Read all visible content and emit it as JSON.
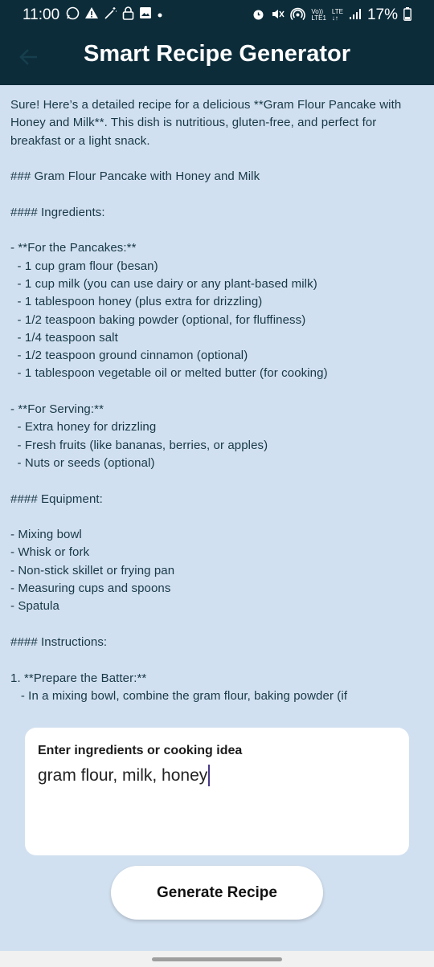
{
  "status_bar": {
    "time": "11:00",
    "left_icons": [
      "whatsapp-icon",
      "warning-icon",
      "magic-icon",
      "lock-icon",
      "image-icon",
      "dot-icon"
    ],
    "right_icons": [
      "alarm-icon",
      "mute-icon",
      "hotspot-icon",
      "volte-icon",
      "lte-icon",
      "signal-icon",
      "battery-icon"
    ],
    "volte_top": "Vo))",
    "volte_bottom": "LTE1",
    "lte_top": "LTE",
    "lte_bottom": "↓↑",
    "battery_pct": "17%"
  },
  "app_bar": {
    "title": "Smart Recipe Generator",
    "back_icon": "arrow-back-icon"
  },
  "recipe": {
    "text": "Sure! Here’s a detailed recipe for a delicious **Gram Flour Pancake with Honey and Milk**. This dish is nutritious, gluten-free, and perfect for breakfast or a light snack.\n\n### Gram Flour Pancake with Honey and Milk\n\n#### Ingredients:\n\n- **For the Pancakes:**\n  - 1 cup gram flour (besan)\n  - 1 cup milk (you can use dairy or any plant-based milk)\n  - 1 tablespoon honey (plus extra for drizzling)\n  - 1/2 teaspoon baking powder (optional, for fluffiness)\n  - 1/4 teaspoon salt\n  - 1/2 teaspoon ground cinnamon (optional)\n  - 1 tablespoon vegetable oil or melted butter (for cooking)\n\n- **For Serving:**\n  - Extra honey for drizzling\n  - Fresh fruits (like bananas, berries, or apples)\n  - Nuts or seeds (optional)\n\n#### Equipment:\n\n- Mixing bowl\n- Whisk or fork\n- Non-stick skillet or frying pan\n- Measuring cups and spoons\n- Spatula\n\n#### Instructions:\n\n1. **Prepare the Batter:**\n   - In a mixing bowl, combine the gram flour, baking powder (if"
  },
  "input": {
    "label": "Enter ingredients or cooking idea",
    "value": "gram flour, milk, honey"
  },
  "actions": {
    "generate_label": "Generate Recipe"
  },
  "colors": {
    "app_bar": "#0c2c3a",
    "background": "#d1e0f0",
    "text": "#173847",
    "card": "#ffffff"
  }
}
